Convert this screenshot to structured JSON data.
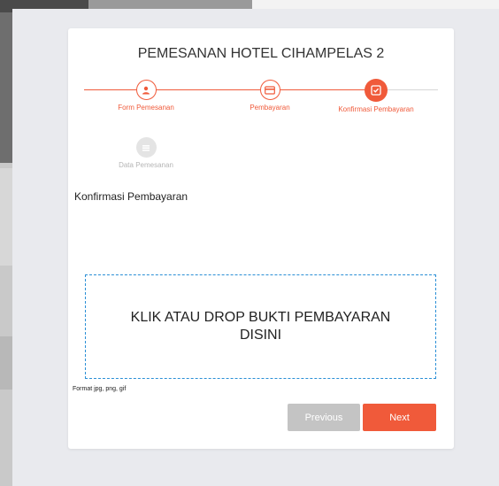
{
  "modal": {
    "title": "PEMESANAN HOTEL CIHAMPELAS 2"
  },
  "wizard": {
    "steps": [
      {
        "label": "Form Pemesanan",
        "icon": "user-icon",
        "state": "done"
      },
      {
        "label": "Pembayaran",
        "icon": "credit-card-icon",
        "state": "done"
      },
      {
        "label": "Konfirmasi Pembayaran",
        "icon": "check-square-icon",
        "state": "active"
      },
      {
        "label": "Data Pemesanan",
        "icon": "list-icon",
        "state": "disabled"
      }
    ]
  },
  "content": {
    "heading": "Konfirmasi Pembayaran",
    "dropzone_text": "KLIK ATAU DROP BUKTI PEMBAYARAN DISINI",
    "format_hint": "Format jpg, png, gif"
  },
  "buttons": {
    "previous": "Previous",
    "next": "Next"
  },
  "colors": {
    "accent": "#f05a3a",
    "disabled": "#c4c4c4",
    "dropzone_border": "#2a8fd6"
  }
}
